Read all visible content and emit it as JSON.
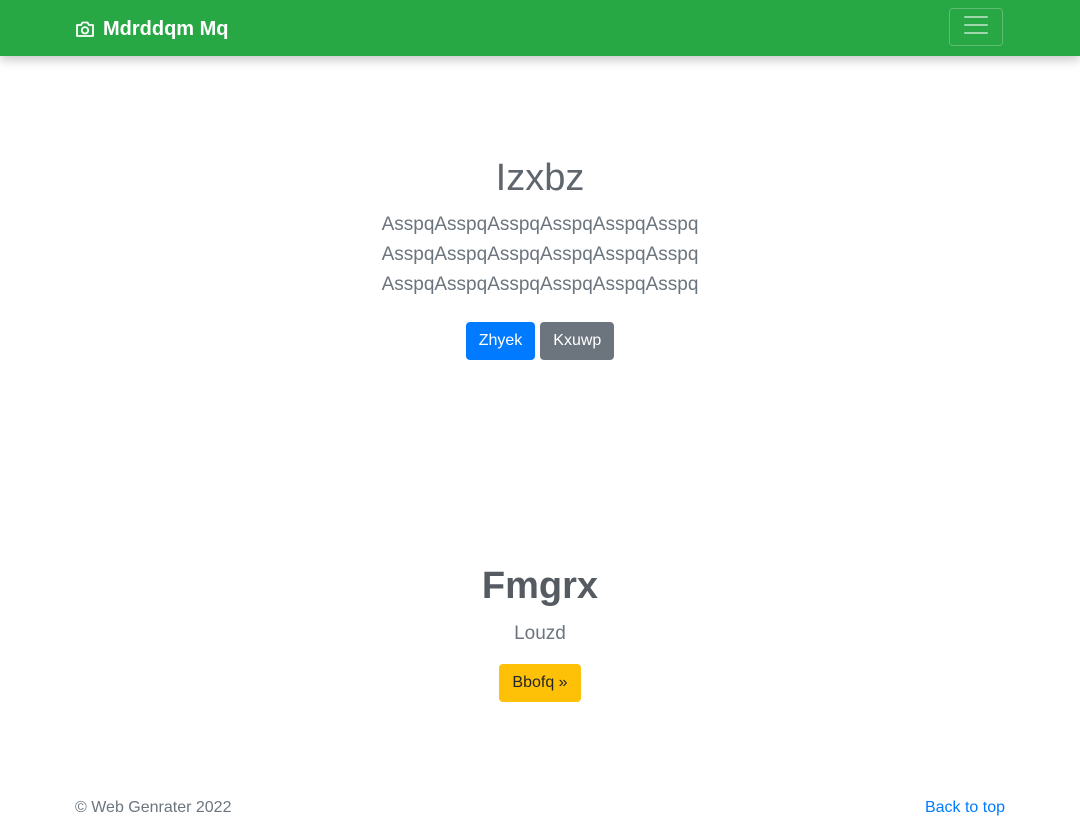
{
  "navbar": {
    "brand_label": "Mdrddqm Mq",
    "brand_icon": "camera-icon",
    "toggler_icon": "hamburger-menu-icon",
    "background_color": "#28a745"
  },
  "hero": {
    "title": "Izxbz",
    "lead": "AsspqAsspqAsspqAsspqAsspqAsspq AsspqAsspqAsspqAsspqAsspqAsspq AsspqAsspqAsspqAsspqAsspqAsspq",
    "primary_button_label": "Zhyek",
    "secondary_button_label": "Kxuwp"
  },
  "section2": {
    "title": "Fmgrx",
    "subtitle": "Louzd",
    "button_label": "Bbofq »"
  },
  "footer": {
    "copyright": "© Web Genrater 2022",
    "back_to_top": "Back to top"
  },
  "colors": {
    "primary": "#007bff",
    "secondary": "#6c757d",
    "warning": "#ffc107",
    "success": "#28a745"
  }
}
